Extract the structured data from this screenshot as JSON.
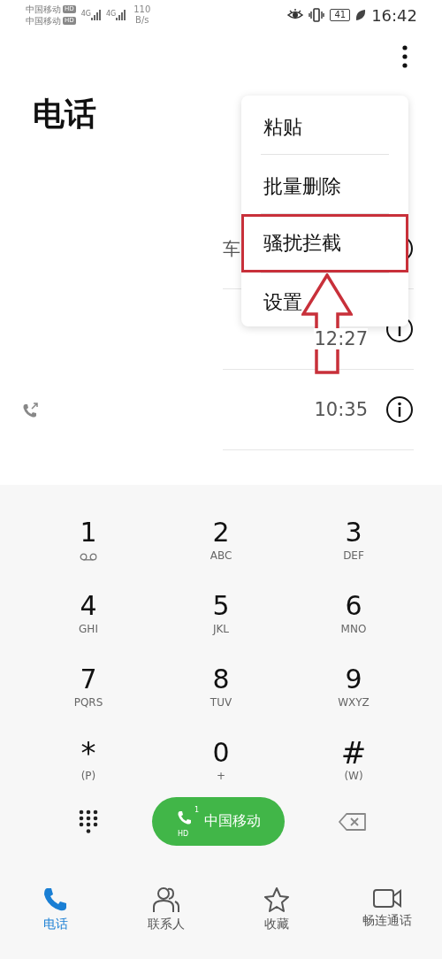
{
  "status_bar": {
    "carriers": [
      {
        "name": "中国移动",
        "badge": "HD"
      },
      {
        "name": "中国移动",
        "badge": "HD"
      }
    ],
    "signals": [
      {
        "network": "4G"
      },
      {
        "network": "4G"
      }
    ],
    "speed": "110",
    "speed_unit": "B/s",
    "battery": "41",
    "time": "16:42"
  },
  "title": "电话",
  "calls": [
    {
      "name": "车",
      "outgoing": false
    },
    {
      "time": "12:27",
      "outgoing": false
    },
    {
      "time": "10:35",
      "outgoing": true
    }
  ],
  "menu": [
    {
      "label": "粘贴",
      "highlighted": false
    },
    {
      "label": "批量删除",
      "highlighted": false
    },
    {
      "label": "骚扰拦截",
      "highlighted": true
    },
    {
      "label": "设置",
      "highlighted": false
    }
  ],
  "keys": [
    {
      "kind": "voicemail",
      "digit": "1"
    },
    {
      "kind": "letters",
      "digit": "2",
      "sub": "ABC"
    },
    {
      "kind": "letters",
      "digit": "3",
      "sub": "DEF"
    },
    {
      "kind": "letters",
      "digit": "4",
      "sub": "GHI"
    },
    {
      "kind": "letters",
      "digit": "5",
      "sub": "JKL"
    },
    {
      "kind": "letters",
      "digit": "6",
      "sub": "MNO"
    },
    {
      "kind": "letters",
      "digit": "7",
      "sub": "PQRS"
    },
    {
      "kind": "letters",
      "digit": "8",
      "sub": "TUV"
    },
    {
      "kind": "letters",
      "digit": "9",
      "sub": "WXYZ"
    },
    {
      "kind": "letters",
      "digit": "*",
      "sub": "(P)"
    },
    {
      "kind": "letters",
      "digit": "0",
      "sub": "+"
    },
    {
      "kind": "letters",
      "digit": "#",
      "sub": "(W)"
    }
  ],
  "call_button": {
    "label": "中国移动",
    "sim": "1",
    "hd": "HD"
  },
  "tabs": [
    {
      "label": "电话",
      "kind": "phone",
      "selected": true
    },
    {
      "label": "联系人",
      "kind": "contacts",
      "selected": false
    },
    {
      "label": "收藏",
      "kind": "star",
      "selected": false
    },
    {
      "label": "畅连通话",
      "kind": "video",
      "selected": false
    }
  ]
}
